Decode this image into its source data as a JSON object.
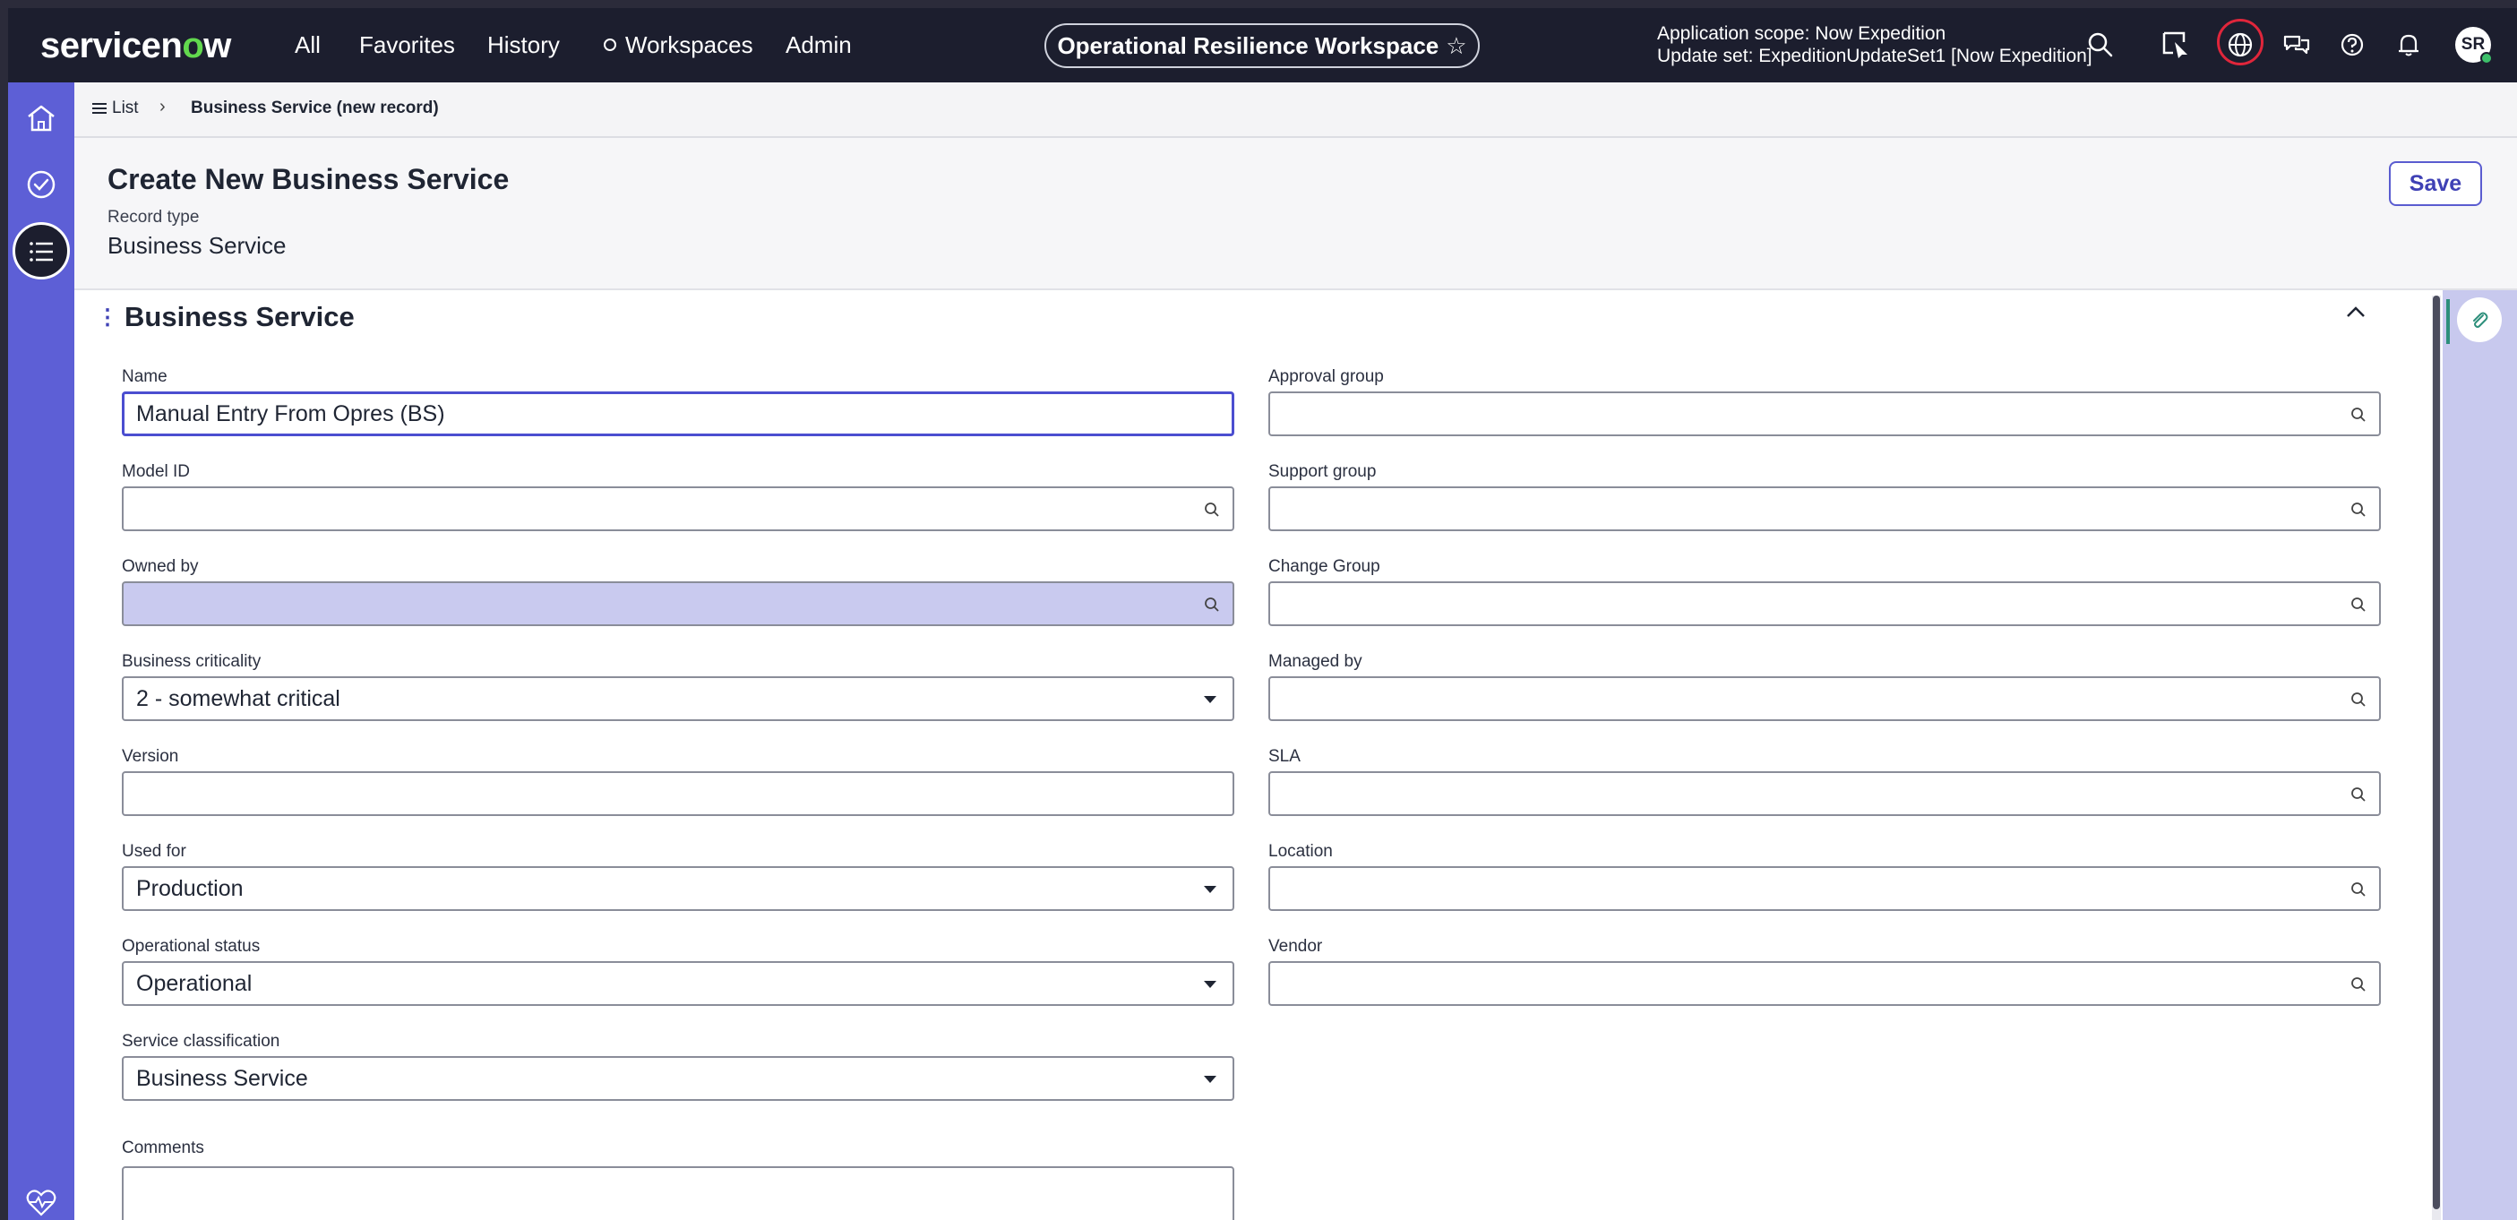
{
  "topbar": {
    "logo_pre": "servicen",
    "logo_o": "o",
    "logo_post": "w",
    "nav": [
      "All",
      "Favorites",
      "History",
      "Workspaces",
      "Admin"
    ],
    "workspace": "Operational Resilience Workspace",
    "star": "☆",
    "scope_line1": "Application scope: Now Expedition",
    "scope_line2": "Update set: ExpeditionUpdateSet1 [Now Expedition]",
    "avatar": "SR"
  },
  "breadcrumb": {
    "list_label": "List",
    "separator": "›",
    "current": "Business Service (new record)"
  },
  "header": {
    "title": "Create New Business Service",
    "record_type_label": "Record type",
    "record_type_value": "Business Service",
    "save_label": "Save"
  },
  "section": {
    "dots": "⋮",
    "title": "Business Service"
  },
  "fields": {
    "name": {
      "label": "Name",
      "value": "Manual Entry From Opres (BS)"
    },
    "model_id": {
      "label": "Model ID",
      "value": ""
    },
    "owned_by": {
      "label": "Owned by",
      "value": ""
    },
    "business_criticality": {
      "label": "Business criticality",
      "value": "2 - somewhat critical"
    },
    "version": {
      "label": "Version",
      "value": ""
    },
    "used_for": {
      "label": "Used for",
      "value": "Production"
    },
    "operational_status": {
      "label": "Operational status",
      "value": "Operational"
    },
    "service_classification": {
      "label": "Service classification",
      "value": "Business Service"
    },
    "approval_group": {
      "label": "Approval group",
      "value": ""
    },
    "support_group": {
      "label": "Support group",
      "value": ""
    },
    "change_group": {
      "label": "Change Group",
      "value": ""
    },
    "managed_by": {
      "label": "Managed by",
      "value": ""
    },
    "sla": {
      "label": "SLA",
      "value": ""
    },
    "location": {
      "label": "Location",
      "value": ""
    },
    "vendor": {
      "label": "Vendor",
      "value": ""
    },
    "comments": {
      "label": "Comments",
      "value": ""
    }
  },
  "colors": {
    "topbar": "#1c1e2e",
    "rail": "#5d5fd6",
    "accent": "#4b4ed0",
    "logo_o": "#62d84e",
    "globe_ring": "#e0263b"
  },
  "icons": [
    "home-icon",
    "approvals-icon",
    "list-icon",
    "activity-icon",
    "search-icon",
    "pointer-icon",
    "globe-icon",
    "chat-icon",
    "help-icon",
    "bell-icon",
    "paperclip-icon",
    "chevron-up-icon"
  ]
}
